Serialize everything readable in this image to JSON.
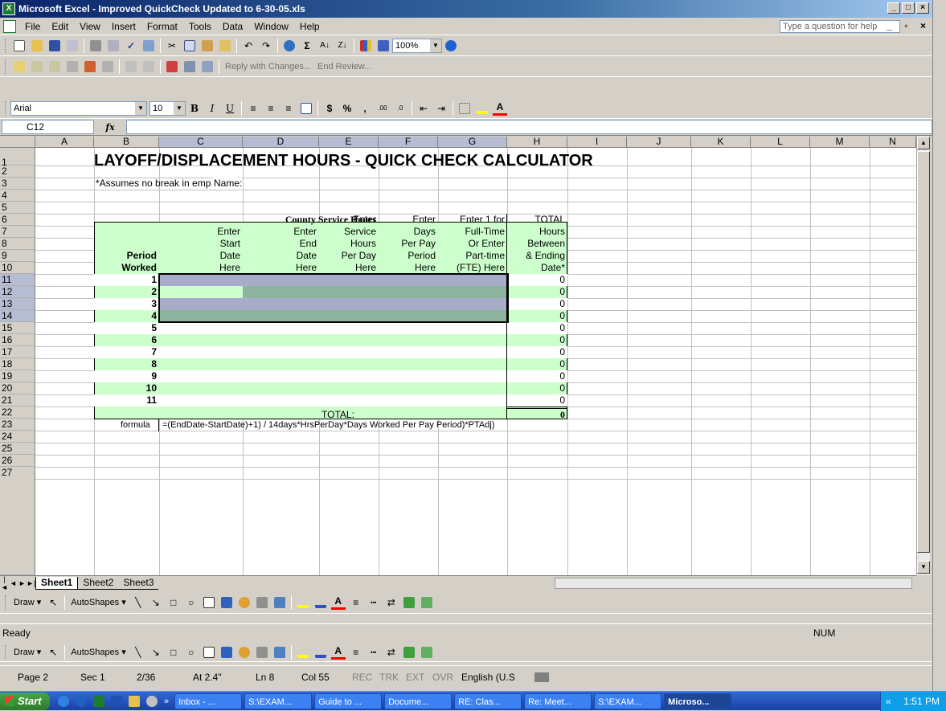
{
  "window": {
    "title": "Microsoft Excel - Improved QuickCheck Updated to 6-30-05.xls"
  },
  "menu": {
    "items": [
      "File",
      "Edit",
      "View",
      "Insert",
      "Format",
      "Tools",
      "Data",
      "Window",
      "Help"
    ],
    "help_placeholder": "Type a question for help"
  },
  "toolbar": {
    "zoom": "100%",
    "reply_label": "Reply with Changes...",
    "end_review_label": "End Review...",
    "font_name": "Arial",
    "font_size": "10"
  },
  "formula_bar": {
    "name_box": "C12",
    "fx": "fx",
    "content": ""
  },
  "columns": [
    "A",
    "B",
    "C",
    "D",
    "E",
    "F",
    "G",
    "H",
    "I",
    "J",
    "K",
    "L",
    "M",
    "N"
  ],
  "rows": [
    "1",
    "2",
    "3",
    "4",
    "5",
    "6",
    "7",
    "8",
    "9",
    "10",
    "11",
    "12",
    "13",
    "14",
    "15",
    "16",
    "17",
    "18",
    "19",
    "20",
    "21",
    "22",
    "23",
    "24",
    "25",
    "26",
    "27"
  ],
  "sheet": {
    "title": "LAYOFF/DISPLACEMENT HOURS - QUICK CHECK CALCULATOR",
    "note": "*Assumes no break in emp",
    "name_label": "Name:",
    "table_header": "County Service Hours",
    "headers": {
      "b": [
        "Period",
        "Worked"
      ],
      "c": [
        "Enter",
        "Start",
        "Date",
        "Here"
      ],
      "d": [
        "Enter",
        "End",
        "Date",
        "Here"
      ],
      "e": [
        "Enter",
        "Service",
        "Hours",
        "Per Day",
        "Here"
      ],
      "f": [
        "Enter",
        "Days",
        "Per Pay",
        "Period",
        "Here"
      ],
      "g": [
        "Enter 1 for",
        "Full-Time",
        "Or Enter",
        "Part-time",
        "(FTE) Here"
      ],
      "h": [
        "TOTAL",
        "Hours",
        "Between",
        "& Ending",
        "Date*"
      ]
    },
    "periods": [
      "1",
      "2",
      "3",
      "4",
      "5",
      "6",
      "7",
      "8",
      "9",
      "10",
      "11"
    ],
    "totals": [
      "0",
      "0",
      "0",
      "0",
      "0",
      "0",
      "0",
      "0",
      "0",
      "0",
      "0"
    ],
    "total_label": "TOTAL:",
    "grand_total": "0",
    "formula_label": "formula",
    "formula_text": "=(EndDate-StartDate)+1) / 14days*HrsPerDay*Days Worked Per Pay Period)*PTAdj)"
  },
  "sheet_tabs": [
    "Sheet1",
    "Sheet2",
    "Sheet3"
  ],
  "draw_toolbar": {
    "draw_label": "Draw",
    "autoshapes_label": "AutoShapes"
  },
  "status": {
    "left": "Ready",
    "num": "NUM"
  },
  "word_status": {
    "page": "Page 2",
    "sec": "Sec 1",
    "pages": "2/36",
    "at": "At 2.4\"",
    "ln": "Ln 8",
    "col": "Col 55",
    "rec": "REC",
    "trk": "TRK",
    "ext": "EXT",
    "ovr": "OVR",
    "lang": "English (U.S"
  },
  "taskbar": {
    "start": "Start",
    "items": [
      "Inbox - ...",
      "S:\\EXAM...",
      "Guide to ...",
      "Docume...",
      "RE: Clas...",
      "Re: Meet...",
      "S:\\EXAM...",
      "Microso..."
    ],
    "time": "1:51 PM"
  }
}
